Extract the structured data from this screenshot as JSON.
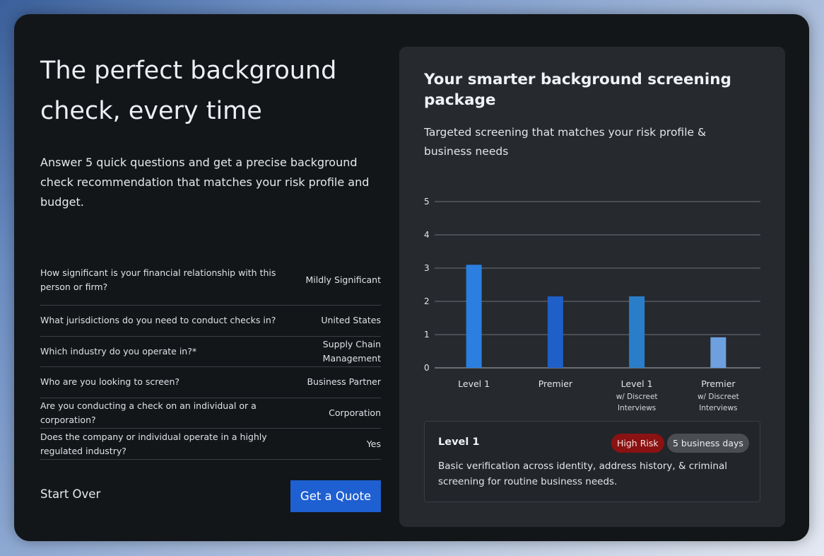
{
  "hero": {
    "title": "The perfect background check, every time",
    "subtitle": "Answer 5 quick questions and get a precise background check recommendation that matches your risk profile and budget."
  },
  "questions": [
    {
      "q": "How significant is your financial relationship with this person or firm?",
      "a": "Mildly Significant"
    },
    {
      "q": "What jurisdictions do you need to conduct checks in?",
      "a": "United States"
    },
    {
      "q": "Which industry do you operate in?*",
      "a": "Supply Chain Management"
    },
    {
      "q": "Who are you looking to screen?",
      "a": "Business Partner"
    },
    {
      "q": "Are you conducting a check on an individual or a corporation?",
      "a": "Corporation"
    },
    {
      "q": "Does the company or individual operate in a highly regulated industry?",
      "a": "Yes"
    }
  ],
  "actions": {
    "start_over": "Start Over",
    "get_quote": "Get a Quote"
  },
  "panel": {
    "title": "Your smarter background screening package",
    "subtitle": "Targeted screening that matches your risk profile & business needs"
  },
  "chart_data": {
    "type": "bar",
    "categories": [
      {
        "name": "Level 1",
        "sub": ""
      },
      {
        "name": "Premier",
        "sub": ""
      },
      {
        "name": "Level 1",
        "sub": "w/ Discreet Interviews"
      },
      {
        "name": "Premier",
        "sub": "w/ Discreet Interviews"
      }
    ],
    "values": [
      3.1,
      2.15,
      2.15,
      0.92
    ],
    "bar_colors": [
      "#2b7fe0",
      "#1f5fc8",
      "#2a7ec9",
      "#6ea0e0"
    ],
    "yticks": [
      0,
      1,
      2,
      3,
      4,
      5
    ],
    "ylim": [
      0,
      5
    ],
    "grid": true
  },
  "recommendation": {
    "title": "Level 1",
    "risk_badge": "High Risk",
    "days_badge": "5 business days",
    "description": "Basic verification across identity, address history, & criminal screening for routine business needs."
  }
}
